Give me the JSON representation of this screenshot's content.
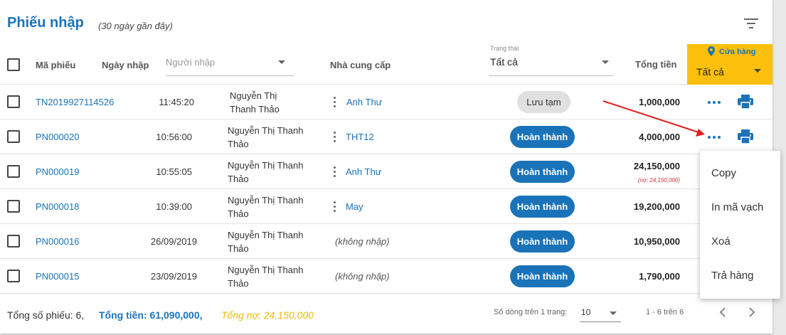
{
  "header": {
    "title": "Phiếu nhập",
    "subtitle": "(30 ngày gần đây)"
  },
  "columns": {
    "code": "Mã phiếu",
    "date": "Ngày nhập",
    "importer_placeholder": "Người nhập",
    "supplier": "Nhà cung cấp",
    "status_label": "Trạng thái",
    "status_value": "Tất cả",
    "total": "Tổng tiền",
    "store_label": "Cửa hàng",
    "store_value": "Tất cả"
  },
  "rows": [
    {
      "code": "TN2019927114526",
      "date": "11:45:20",
      "person": "Nguyễn Thị Thanh Thảo",
      "supplier": "Anh Thư",
      "status": "Lưu tạm",
      "total": "1,000,000",
      "debt": ""
    },
    {
      "code": "PN000020",
      "date": "10:56:00",
      "person": "Nguyễn Thị Thanh Thảo",
      "supplier": "THT12",
      "status": "Hoàn thành",
      "total": "4,000,000",
      "debt": ""
    },
    {
      "code": "PN000019",
      "date": "10:55:05",
      "person": "Nguyễn Thị Thanh Thảo",
      "supplier": "Anh Thư",
      "status": "Hoàn thành",
      "total": "24,150,000",
      "debt": "(nợ: 24,150,000)"
    },
    {
      "code": "PN000018",
      "date": "10:39:00",
      "person": "Nguyễn Thị Thanh Thảo",
      "supplier": "May",
      "status": "Hoàn thành",
      "total": "19,200,000",
      "debt": ""
    },
    {
      "code": "PN000016",
      "date": "26/09/2019",
      "person": "Nguyễn Thị Thanh Thảo",
      "supplier": "(không nhập)",
      "status": "Hoàn thành",
      "total": "10,950,000",
      "debt": ""
    },
    {
      "code": "PN000015",
      "date": "23/09/2019",
      "person": "Nguyễn Thị Thanh Thảo",
      "supplier": "(không nhập)",
      "status": "Hoàn thành",
      "total": "1,790,000",
      "debt": ""
    }
  ],
  "footer": {
    "count": "Tổng số phiếu: 6,",
    "total": "Tổng tiền: 61,090,000,",
    "debt": "Tổng nợ: 24,150,000",
    "rows_per_page_label": "Số dòng trên 1 trang:",
    "rows_per_page": "10",
    "range": "1 - 6 trên 6"
  },
  "menu": {
    "items": [
      "Copy",
      "In mã vạch",
      "Xoá",
      "Trả hàng"
    ]
  },
  "colors": {
    "accent": "#1a73b8",
    "store_bg": "#fcbf0b",
    "debt": "#d32f2f",
    "footer_debt": "#f5b800"
  }
}
